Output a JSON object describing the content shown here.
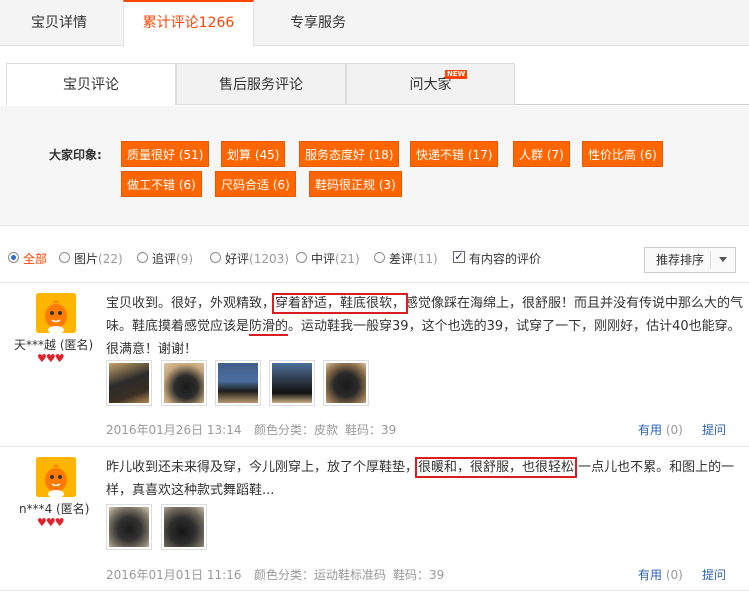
{
  "top_tabs": [
    {
      "label": "宝贝详情"
    },
    {
      "label": "累计评论1266"
    },
    {
      "label": "专享服务"
    }
  ],
  "sub_tabs": [
    {
      "label": "宝贝评论"
    },
    {
      "label": "售后服务评论"
    },
    {
      "label": "问大家",
      "badge": "NEW"
    }
  ],
  "impressions": {
    "label": "大家印象:",
    "tags": [
      "质量很好 (51)",
      "划算 (45)",
      "服务态度好 (18)",
      "快递不错 (17)",
      "人群 (7)",
      "性价比高 (6)",
      "做工不错 (6)",
      "尺码合适 (6)",
      "鞋码很正规 (3)"
    ]
  },
  "filters": {
    "options": [
      {
        "label": "全部",
        "count": ""
      },
      {
        "label": "图片",
        "count": "(22)"
      },
      {
        "label": "追评",
        "count": "(9)"
      },
      {
        "label": "好评",
        "count": "(1203)"
      },
      {
        "label": "中评",
        "count": "(21)"
      },
      {
        "label": "差评",
        "count": "(11)"
      }
    ],
    "content_only": "有内容的评价",
    "sort_label": "推荐排序"
  },
  "reviews": [
    {
      "user": "天***越 (匿名)",
      "text_parts": [
        "宝贝收到。很好，外观精致，",
        "穿着舒适，鞋底很软，",
        "感觉像踩在海绵上，很舒服！而且并没有传说中那么大的气味。鞋底摸着感觉应该是",
        "防滑的",
        "。运动鞋我一般穿39，这个也选的39，试穿了一下，刚刚好，估计40也能穿。很满意！谢谢！"
      ],
      "date": "2016年01月26日 13:14",
      "attr": "颜色分类：皮款",
      "size": "鞋码：39",
      "useful": "有用",
      "useful_count": "(0)",
      "ask": "提问"
    },
    {
      "user": "n***4 (匿名)",
      "text_parts": [
        "昨儿收到还未来得及穿，今儿刚穿上，放了个厚鞋垫，",
        "很暖和，很舒服，也很轻松",
        "一点儿也不累。和图上的一样，真喜欢这种款式舞蹈鞋..."
      ],
      "date": "2016年01月01日 11:16",
      "attr": "颜色分类：运动鞋标准码",
      "size": "鞋码：39",
      "useful": "有用",
      "useful_count": "(0)",
      "ask": "提问"
    }
  ],
  "colors": {
    "accent": "#ff4400",
    "tag_bg": "#ff6600",
    "highlight_box": "#d81e1e",
    "link": "#2a61b3"
  }
}
